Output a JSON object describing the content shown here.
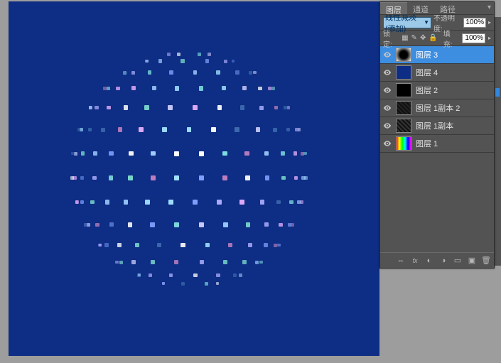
{
  "tabs": {
    "layers": "图层",
    "channels": "通道",
    "paths": "路径"
  },
  "controls": {
    "blend_mode": "线性减淡(添加)",
    "opacity_label": "不透明度:",
    "opacity_value": "100%",
    "lock_label": "锁定:",
    "fill_label": "填充:",
    "fill_value": "100%"
  },
  "layers": [
    {
      "name": "图层 3",
      "selected": true,
      "thumb": "t3"
    },
    {
      "name": "图层 4",
      "selected": false,
      "thumb": "t4"
    },
    {
      "name": "图层 2",
      "selected": false,
      "thumb": "t2"
    },
    {
      "name": "图层 1副本 2",
      "selected": false,
      "thumb": "tc2"
    },
    {
      "name": "图层 1副本",
      "selected": false,
      "thumb": "tc1"
    },
    {
      "name": "图层 1",
      "selected": false,
      "thumb": "t1"
    }
  ],
  "canvas": {
    "bg": "#0e2d84"
  }
}
